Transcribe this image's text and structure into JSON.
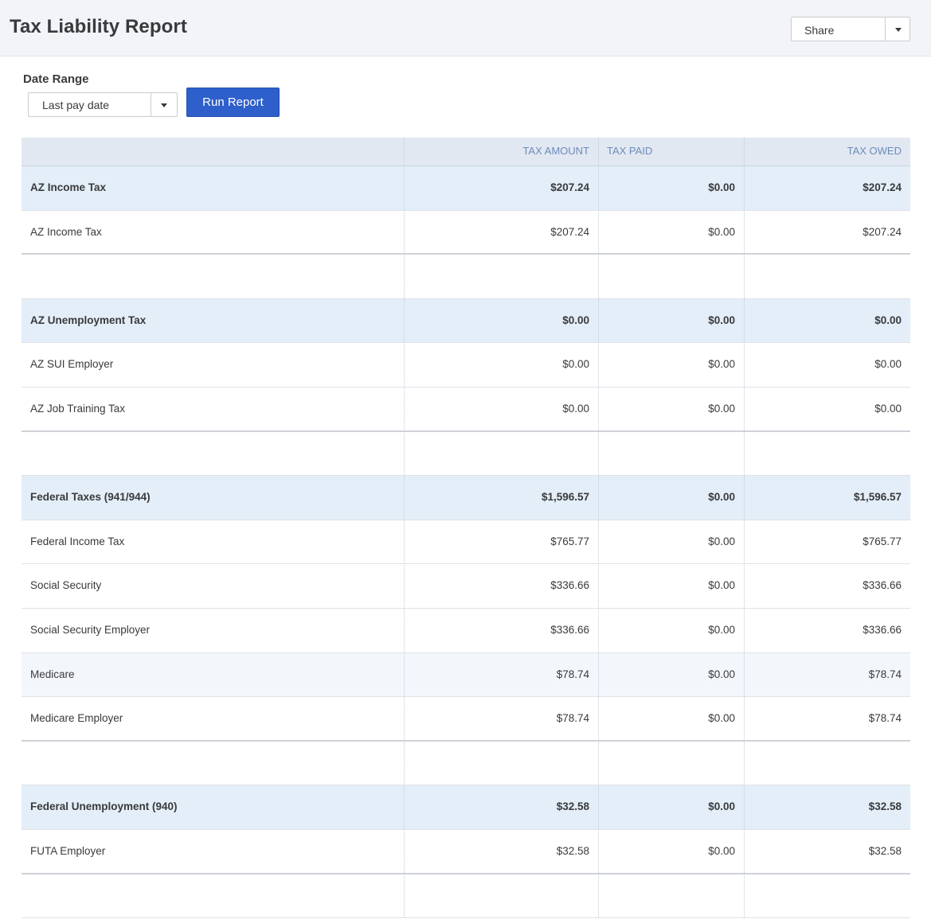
{
  "header": {
    "title": "Tax Liability Report",
    "share_label": "Share"
  },
  "filters": {
    "date_range_label": "Date Range",
    "date_range_value": "Last pay date",
    "run_button": "Run Report"
  },
  "table": {
    "columns": [
      "",
      "TAX AMOUNT",
      "TAX PAID",
      "TAX OWED"
    ],
    "rows": [
      {
        "type": "group",
        "name": "AZ Income Tax",
        "amount": "$207.24",
        "paid": "$0.00",
        "owed": "$207.24"
      },
      {
        "type": "item",
        "name": "AZ Income Tax",
        "amount": "$207.24",
        "paid": "$0.00",
        "owed": "$207.24"
      },
      {
        "type": "blank"
      },
      {
        "type": "group",
        "name": "AZ Unemployment Tax",
        "amount": "$0.00",
        "paid": "$0.00",
        "owed": "$0.00"
      },
      {
        "type": "item",
        "name": "AZ SUI Employer",
        "amount": "$0.00",
        "paid": "$0.00",
        "owed": "$0.00"
      },
      {
        "type": "item",
        "name": "AZ Job Training Tax",
        "amount": "$0.00",
        "paid": "$0.00",
        "owed": "$0.00"
      },
      {
        "type": "blank"
      },
      {
        "type": "group",
        "name": "Federal Taxes (941/944)",
        "amount": "$1,596.57",
        "paid": "$0.00",
        "owed": "$1,596.57"
      },
      {
        "type": "item",
        "name": "Federal Income Tax",
        "amount": "$765.77",
        "paid": "$0.00",
        "owed": "$765.77"
      },
      {
        "type": "item",
        "name": "Social Security",
        "amount": "$336.66",
        "paid": "$0.00",
        "owed": "$336.66"
      },
      {
        "type": "item",
        "name": "Social Security Employer",
        "amount": "$336.66",
        "paid": "$0.00",
        "owed": "$336.66"
      },
      {
        "type": "item",
        "highlight": true,
        "name": "Medicare",
        "amount": "$78.74",
        "paid": "$0.00",
        "owed": "$78.74"
      },
      {
        "type": "item",
        "name": "Medicare Employer",
        "amount": "$78.74",
        "paid": "$0.00",
        "owed": "$78.74"
      },
      {
        "type": "blank"
      },
      {
        "type": "group",
        "name": "Federal Unemployment (940)",
        "amount": "$32.58",
        "paid": "$0.00",
        "owed": "$32.58"
      },
      {
        "type": "item",
        "name": "FUTA Employer",
        "amount": "$32.58",
        "paid": "$0.00",
        "owed": "$32.58"
      },
      {
        "type": "blank"
      }
    ]
  },
  "colors": {
    "run_button": "#2e5fca",
    "group_row": "#e3eef8",
    "header_row": "#e2e8f2",
    "header_text": "#6b8cb8"
  }
}
